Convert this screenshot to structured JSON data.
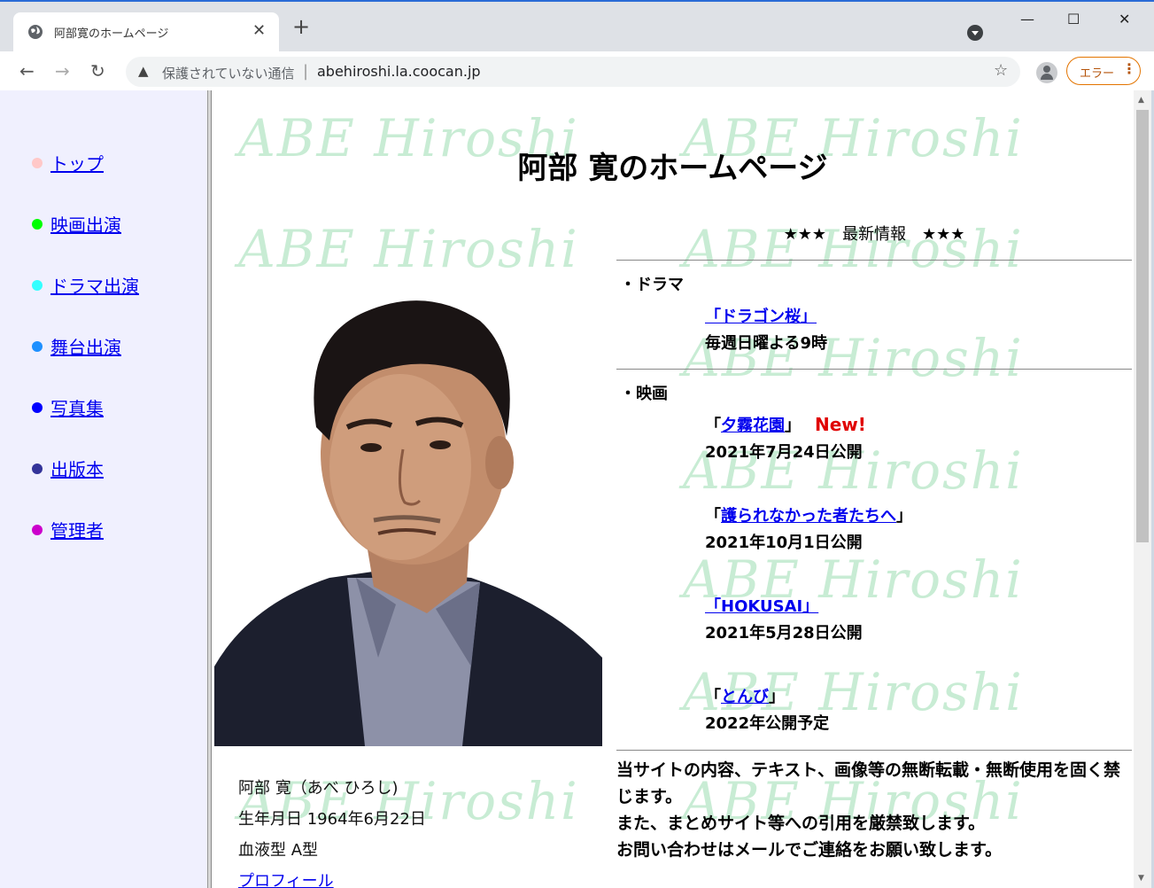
{
  "browser": {
    "tab_title": "阿部寛のホームページ",
    "tab_close": "✕",
    "new_tab": "+",
    "window_buttons": {
      "minimize": "—",
      "maximize": "☐",
      "close": "✕"
    },
    "nav": {
      "back": "←",
      "forward": "→",
      "reload": "↻"
    },
    "security_text": "保護されていない通信",
    "separator": "|",
    "url": "abehiroshi.la.coocan.jp",
    "warning_glyph": "▲",
    "star_glyph": "☆",
    "error_button_label": "エラー",
    "menu_dots": "⋮"
  },
  "sidebar": {
    "items": [
      {
        "label": "トップ",
        "color": "#ffc8c8"
      },
      {
        "label": "映画出演",
        "color": "#00ff00"
      },
      {
        "label": "ドラマ出演",
        "color": "#33ffff"
      },
      {
        "label": "舞台出演",
        "color": "#1e90ff"
      },
      {
        "label": "写真集",
        "color": "#0000ff"
      },
      {
        "label": "出版本",
        "color": "#333399"
      },
      {
        "label": "管理者",
        "color": "#cc00cc"
      }
    ]
  },
  "main": {
    "watermark": "ABE Hiroshi",
    "title": "阿部 寛のホームページ",
    "profile": {
      "name": "阿部 寛（あべ ひろし)",
      "birthday": "生年月日 1964年6月22日",
      "blood": "血液型 A型",
      "link": "プロフィール"
    },
    "news": {
      "header": "★★★　最新情報　★★★",
      "drama_section": "・ドラマ",
      "drama": [
        {
          "title": "「ドラゴン桜」",
          "date": "毎週日曜よる9時"
        }
      ],
      "movie_section": "・映画",
      "movies": [
        {
          "open": "「",
          "title": "夕霧花園",
          "close": "」",
          "badge": "New!",
          "date": "2021年7月24日公開"
        },
        {
          "open": "「",
          "title": "護られなかった者たちへ",
          "close": "」",
          "date": "2021年10月1日公開"
        },
        {
          "open": "",
          "title": "「HOKUSAI」",
          "close": "",
          "date": "2021年5月28日公開"
        },
        {
          "open": "「",
          "title": "とんび",
          "close": "」",
          "date": "2022年公開予定"
        }
      ],
      "notice": [
        "当サイトの内容、テキスト、画像等の無断転載・無断使用を固く禁じます。",
        "また、まとめサイト等への引用を厳禁致します。",
        "お問い合わせはメールでご連絡をお願い致します。"
      ]
    }
  }
}
